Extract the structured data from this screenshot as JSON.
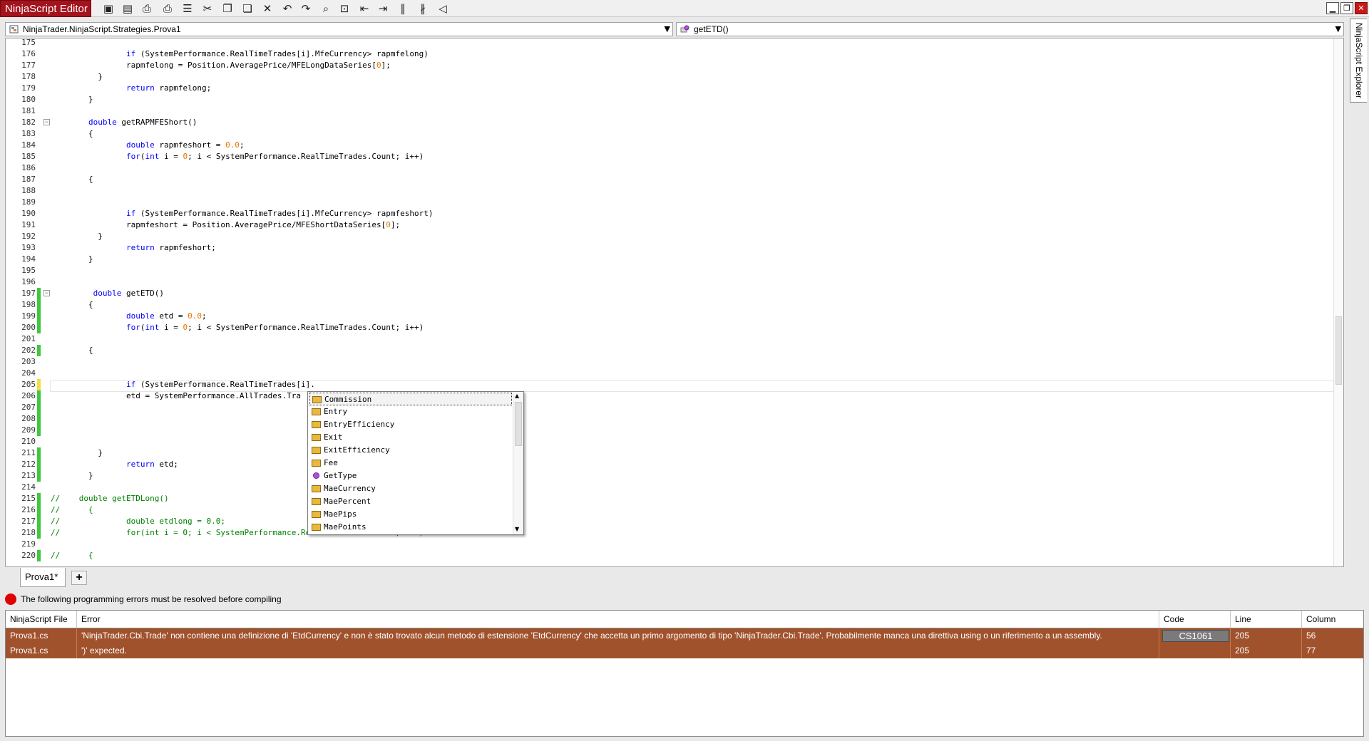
{
  "window": {
    "title": "NinjaScript Editor"
  },
  "toolbar": [
    {
      "icon": "save-icon",
      "glyph": "▣"
    },
    {
      "icon": "save-as-icon",
      "glyph": "▤"
    },
    {
      "icon": "print-icon",
      "glyph": "⎙"
    },
    {
      "icon": "print-preview-icon",
      "glyph": "⎙"
    },
    {
      "icon": "properties-icon",
      "glyph": "☰"
    },
    {
      "icon": "cut-icon",
      "glyph": "✂"
    },
    {
      "icon": "copy-icon",
      "glyph": "❐"
    },
    {
      "icon": "paste-icon",
      "glyph": "❏"
    },
    {
      "icon": "delete-icon",
      "glyph": "✕"
    },
    {
      "icon": "undo-icon",
      "glyph": "↶"
    },
    {
      "icon": "redo-icon",
      "glyph": "↷"
    },
    {
      "icon": "find-icon",
      "glyph": "⌕"
    },
    {
      "icon": "insert-code-icon",
      "glyph": "⊡"
    },
    {
      "icon": "outdent-icon",
      "glyph": "⇤"
    },
    {
      "icon": "indent-icon",
      "glyph": "⇥"
    },
    {
      "icon": "comment-icon",
      "glyph": "∥"
    },
    {
      "icon": "uncomment-icon",
      "glyph": "∦"
    },
    {
      "icon": "visual-studio-icon",
      "glyph": "◁"
    }
  ],
  "window_controls": {
    "minimize": "▁",
    "restore": "❐",
    "close": "✕"
  },
  "class_dropdown": {
    "value": "NinjaTrader.NinjaScript.Strategies.Prova1",
    "arrow": "▼"
  },
  "member_dropdown": {
    "value": "getETD()",
    "arrow": "▼"
  },
  "explorer_tab": {
    "label": "NinjaScript Explorer"
  },
  "code": {
    "lines": [
      {
        "n": "175",
        "t": "",
        "chg": ""
      },
      {
        "n": "176",
        "t": "                <span class='kw'>if</span> (SystemPerformance.RealTimeTrades[i].MfeCurrency&gt; rapmfelong)",
        "chg": ""
      },
      {
        "n": "177",
        "t": "                rapmfelong = Position.AveragePrice/MFELongDataSeries[<span class='num'>0</span>];",
        "chg": ""
      },
      {
        "n": "178",
        "t": "          }",
        "chg": ""
      },
      {
        "n": "179",
        "t": "                <span class='kw'>return</span> rapmfelong;",
        "chg": ""
      },
      {
        "n": "180",
        "t": "        }",
        "chg": ""
      },
      {
        "n": "181",
        "t": "",
        "chg": ""
      },
      {
        "n": "182",
        "t": "        <span class='kw'>double</span> getRAPMFEShort()",
        "chg": "",
        "fold": "−"
      },
      {
        "n": "183",
        "t": "        {",
        "chg": ""
      },
      {
        "n": "184",
        "t": "                <span class='kw'>double</span> rapmfeshort = <span class='num'>0.0</span>;",
        "chg": ""
      },
      {
        "n": "185",
        "t": "                <span class='kw'>for</span>(<span class='kw'>int</span> i = <span class='num'>0</span>; i &lt; SystemPerformance.RealTimeTrades.Count; i++)",
        "chg": ""
      },
      {
        "n": "186",
        "t": "",
        "chg": ""
      },
      {
        "n": "187",
        "t": "        {",
        "chg": ""
      },
      {
        "n": "188",
        "t": "",
        "chg": ""
      },
      {
        "n": "189",
        "t": "",
        "chg": ""
      },
      {
        "n": "190",
        "t": "                <span class='kw'>if</span> (SystemPerformance.RealTimeTrades[i].MfeCurrency&gt; rapmfeshort)",
        "chg": ""
      },
      {
        "n": "191",
        "t": "                rapmfeshort = Position.AveragePrice/MFEShortDataSeries[<span class='num'>0</span>];",
        "chg": ""
      },
      {
        "n": "192",
        "t": "          }",
        "chg": ""
      },
      {
        "n": "193",
        "t": "                <span class='kw'>return</span> rapmfeshort;",
        "chg": ""
      },
      {
        "n": "194",
        "t": "        }",
        "chg": ""
      },
      {
        "n": "195",
        "t": "",
        "chg": ""
      },
      {
        "n": "196",
        "t": "",
        "chg": ""
      },
      {
        "n": "197",
        "t": "         <span class='kw'>double</span> getETD()",
        "chg": "green",
        "fold": "−"
      },
      {
        "n": "198",
        "t": "        {",
        "chg": "green"
      },
      {
        "n": "199",
        "t": "                <span class='kw'>double</span> etd = <span class='num'>0.0</span>;",
        "chg": "green"
      },
      {
        "n": "200",
        "t": "                <span class='kw'>for</span>(<span class='kw'>int</span> i = <span class='num'>0</span>; i &lt; SystemPerformance.RealTimeTrades.Count; i++)",
        "chg": "green"
      },
      {
        "n": "201",
        "t": "",
        "chg": ""
      },
      {
        "n": "202",
        "t": "        {",
        "chg": "green"
      },
      {
        "n": "203",
        "t": "",
        "chg": ""
      },
      {
        "n": "204",
        "t": "",
        "chg": ""
      },
      {
        "n": "205",
        "t": "                <span class='kw'>if</span> (SystemPerformance.RealTimeTrades[i].",
        "chg": "yellow"
      },
      {
        "n": "206",
        "t": "                etd = SystemPerformance.AllTrades.Tra",
        "chg": "green"
      },
      {
        "n": "207",
        "t": "",
        "chg": "green"
      },
      {
        "n": "208",
        "t": "",
        "chg": "green"
      },
      {
        "n": "209",
        "t": "",
        "chg": "green"
      },
      {
        "n": "210",
        "t": "",
        "chg": ""
      },
      {
        "n": "211",
        "t": "          }",
        "chg": "green"
      },
      {
        "n": "212",
        "t": "                <span class='kw'>return</span> etd;",
        "chg": "green"
      },
      {
        "n": "213",
        "t": "        }",
        "chg": "green"
      },
      {
        "n": "214",
        "t": "",
        "chg": ""
      },
      {
        "n": "215",
        "t": "<span class='cm'>//    double getETDLong()</span>",
        "chg": "green"
      },
      {
        "n": "216",
        "t": "<span class='cm'>//      {</span>",
        "chg": "green"
      },
      {
        "n": "217",
        "t": "<span class='cm'>//              double etdlong = 0.0;</span>",
        "chg": "green"
      },
      {
        "n": "218",
        "t": "<span class='cm'>//              for(int i = 0; i &lt; SystemPerformance.RealTimeTrades.Count; i++)</span>",
        "chg": "green"
      },
      {
        "n": "219",
        "t": "",
        "chg": ""
      },
      {
        "n": "220",
        "t": "<span class='cm'>//      {</span>",
        "chg": "green"
      }
    ]
  },
  "autocomplete": {
    "items": [
      {
        "label": "Commission",
        "kind": "property",
        "selected": true
      },
      {
        "label": "Entry",
        "kind": "property"
      },
      {
        "label": "EntryEfficiency",
        "kind": "property"
      },
      {
        "label": "Exit",
        "kind": "property"
      },
      {
        "label": "ExitEfficiency",
        "kind": "property"
      },
      {
        "label": "Fee",
        "kind": "property"
      },
      {
        "label": "GetType",
        "kind": "method"
      },
      {
        "label": "MaeCurrency",
        "kind": "property"
      },
      {
        "label": "MaePercent",
        "kind": "property"
      },
      {
        "label": "MaePips",
        "kind": "property"
      },
      {
        "label": "MaePoints",
        "kind": "property"
      }
    ],
    "scroll_up": "▲",
    "scroll_down": "▼"
  },
  "tabs": {
    "active": "Prova1*",
    "add": "+"
  },
  "status": {
    "message": "The following programming errors must be resolved before compiling"
  },
  "errors": {
    "columns": [
      "NinjaScript File",
      "Error",
      "Code",
      "Line",
      "Column"
    ],
    "rows": [
      {
        "file": "Prova1.cs",
        "error": "'NinjaTrader.Cbi.Trade' non contiene una definizione di 'EtdCurrency' e non è stato trovato alcun metodo di estensione 'EtdCurrency' che accetta un primo argomento di tipo 'NinjaTrader.Cbi.Trade'. Probabilmente manca una direttiva using o un riferimento a un assembly.",
        "code": "CS1061",
        "line": "205",
        "column": "56"
      },
      {
        "file": "Prova1.cs",
        "error": "')' expected.",
        "code": "",
        "line": "205",
        "column": "77"
      }
    ]
  },
  "colors": {
    "title_red": "#a4121c",
    "error_row": "#a0522d",
    "change_green": "#3fc83f",
    "change_yellow": "#f0e040"
  }
}
